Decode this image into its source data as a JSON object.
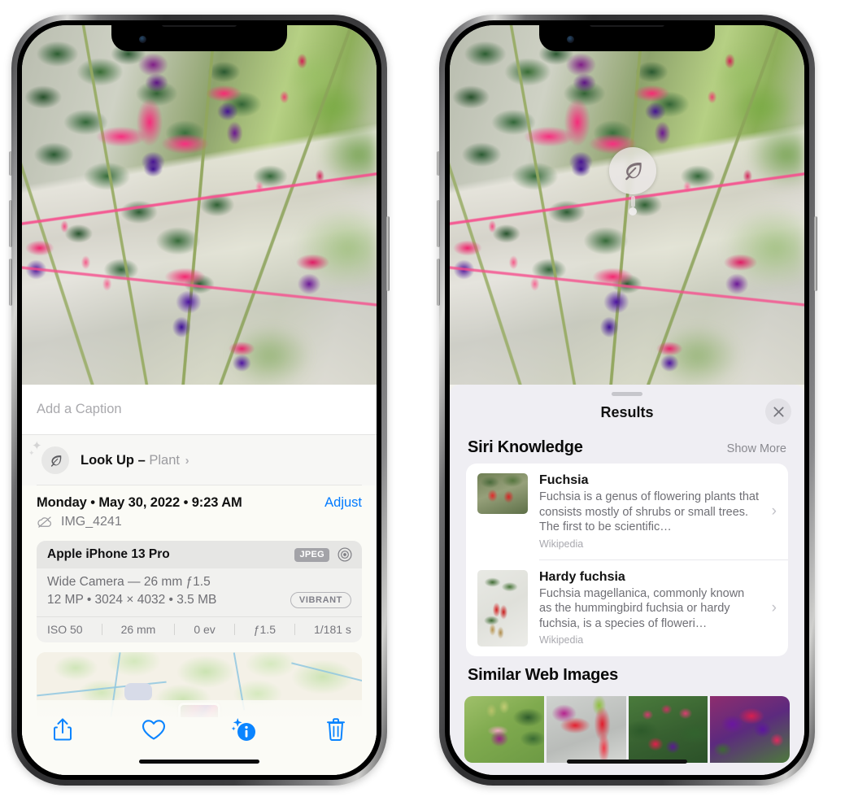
{
  "left_phone": {
    "caption": {
      "placeholder": "Add a Caption",
      "value": ""
    },
    "lookup": {
      "label": "Look Up",
      "dash": " – ",
      "kind": "Plant",
      "chevron": "›",
      "icon": "leaf-icon"
    },
    "metadata": {
      "date_line": "Monday • May 30, 2022 • 9:23 AM",
      "adjust_label": "Adjust",
      "filename": "IMG_4241",
      "cloud_icon": "icloud-slash-icon"
    },
    "camera_card": {
      "model": "Apple iPhone 13 Pro",
      "format_badge": "JPEG",
      "aperture_icon": "aperture-icon",
      "lens": "Wide Camera — 26 mm ƒ1.5",
      "specs": "12 MP • 3024 × 4032 • 3.5 MB",
      "style_badge": "VIBRANT",
      "exif": [
        "ISO 50",
        "26 mm",
        "0 ev",
        "ƒ1.5",
        "1/181 s"
      ]
    },
    "toolbar": [
      {
        "name": "share-icon",
        "label": "Share"
      },
      {
        "name": "heart-icon",
        "label": "Favorite"
      },
      {
        "name": "info-sparkle-icon",
        "label": "Info"
      },
      {
        "name": "trash-icon",
        "label": "Delete"
      }
    ]
  },
  "right_phone": {
    "badge": {
      "icon": "leaf-icon"
    },
    "results": {
      "title": "Results",
      "close_label": "✕",
      "sections": [
        {
          "title": "Siri Knowledge",
          "action": "Show More",
          "items": [
            {
              "title": "Fuchsia",
              "description": "Fuchsia is a genus of flowering plants that consists mostly of shrubs or small trees. The first to be scientific…",
              "source": "Wikipedia",
              "chevron": "›"
            },
            {
              "title": "Hardy fuchsia",
              "description": "Fuchsia magellanica, commonly known as the hummingbird fuchsia or hardy fuchsia, is a species of floweri…",
              "source": "Wikipedia",
              "chevron": "›"
            }
          ]
        },
        {
          "title": "Similar Web Images",
          "images": [
            "web-image-1",
            "web-image-2",
            "web-image-3",
            "web-image-4"
          ]
        }
      ]
    }
  },
  "colors": {
    "accent_blue": "#007aff",
    "sheet_bg": "#fbfbf6",
    "results_bg": "#efeef3",
    "card_white": "#ffffff",
    "secondary_text": "#6f6f75",
    "tertiary_text": "#a8a8ae"
  }
}
